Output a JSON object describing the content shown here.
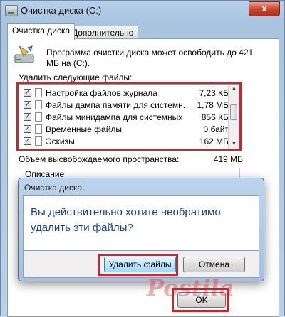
{
  "window": {
    "title": "Очистка диска  (C:)",
    "close_glyph": "x"
  },
  "tabs": [
    {
      "label": "Очистка диска",
      "active": true
    },
    {
      "label": "Дополнительно",
      "active": false
    }
  ],
  "intro_text": "Программа очистки диска может освободить до 421 МБ на  (C:).",
  "files_label": "Удалить следующие файлы:",
  "files": [
    {
      "name": "Настройка файлов журнала",
      "size": "7,23 КБ",
      "checked": true
    },
    {
      "name": "Файлы дампа памяти для системн...",
      "size": "1,78 МБ",
      "checked": true
    },
    {
      "name": "Файлы минидампа для системных ...",
      "size": "856 КБ",
      "checked": true
    },
    {
      "name": "Временные файлы",
      "size": "0 байт",
      "checked": true
    },
    {
      "name": "Эскизы",
      "size": "162 МБ",
      "checked": true
    }
  ],
  "space_label": "Объем высвобождаемого пространства:",
  "space_value": "419 МБ",
  "description_label": "Описание",
  "dialog": {
    "title": "Очистка диска",
    "message": "Вы действительно хотите необратимо удалить эти файлы?",
    "delete_button": "Удалить файлы",
    "cancel_button": "Отмена"
  },
  "ok_button": "OK",
  "watermark": "Postila",
  "colors": {
    "highlight": "#d3232a",
    "dialog_text": "#1b3f94"
  }
}
